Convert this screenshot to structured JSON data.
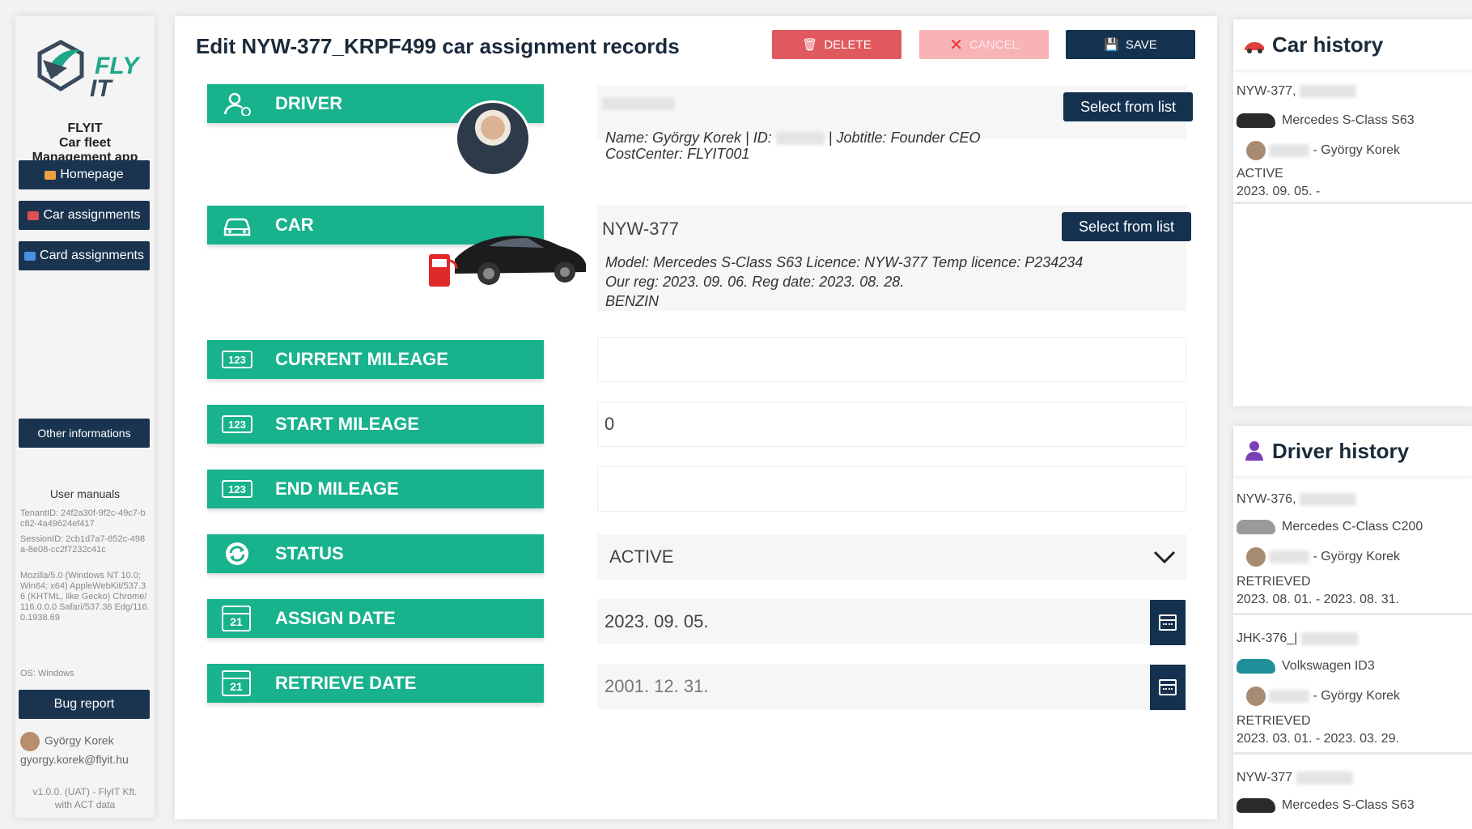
{
  "sidebar": {
    "logo_text_1": "FLY",
    "logo_text_2": "IT",
    "brand_name": "FLYIT",
    "brand_subtitle_1": "Car fleet",
    "brand_subtitle_2": "Management app",
    "nav": [
      {
        "label": "Homepage",
        "icon": "home-icon",
        "icon_color": "#f0a040"
      },
      {
        "label": "Car assignments",
        "icon": "car-icon",
        "icon_color": "#e05050"
      },
      {
        "label": "Card assignments",
        "icon": "card-icon",
        "icon_color": "#4a90e2"
      }
    ],
    "other_info_label": "Other informations",
    "user_manuals_label": "User manuals",
    "tenant_id": "TenantID: 24f2a30f-9f2c-49c7-bc82-4a49624ef417",
    "session_id": "SessionID: 2cb1d7a7-852c-498a-8e08-cc2f7232c41c",
    "user_agent": "Mozilla/5.0 (Windows NT 10.0; Win64; x64) AppleWebKit/537.36 (KHTML, like Gecko) Chrome/116.0.0.0 Safari/537.36 Edg/116.0.1938.69",
    "os": "OS: Windows",
    "bug_report_label": "Bug report",
    "user_name": "György Korek",
    "user_email": "gyorgy.korek@flyit.hu",
    "version_1": "v1.0.0. (UAT) - FlyIT Kft.",
    "version_2": "with ACT data"
  },
  "main": {
    "title": "Edit NYW-377_KRPF499 car assignment records",
    "delete_label": "DELETE",
    "cancel_label": "CANCEL",
    "save_label": "SAVE",
    "driver": {
      "label": "DRIVER",
      "select_label": "Select from list",
      "details_1_a": "Name: György Korek | ID:",
      "details_1_b": "| Jobtitle: Founder CEO",
      "details_2": "CostCenter: FLYIT001"
    },
    "car": {
      "label": "CAR",
      "value": "NYW-377",
      "select_label": "Select from list",
      "details_1": "Model: Mercedes S-Class S63 Licence: NYW-377 Temp licence: P234234",
      "details_2": "Our reg: 2023. 09. 06. Reg date: 2023. 08. 28.",
      "details_3": "BENZIN"
    },
    "current_mileage": {
      "label": "CURRENT MILEAGE",
      "badge": "123",
      "value": ""
    },
    "start_mileage": {
      "label": "START MILEAGE",
      "badge": "123",
      "value": "0"
    },
    "end_mileage": {
      "label": "END MILEAGE",
      "badge": "123",
      "value": ""
    },
    "status": {
      "label": "STATUS",
      "value": "ACTIVE"
    },
    "assign_date": {
      "label": "ASSIGN DATE",
      "cal_day": "21",
      "value": "2023. 09. 05."
    },
    "retrieve_date": {
      "label": "RETRIEVE DATE",
      "cal_day": "21",
      "value": "2001. 12. 31."
    }
  },
  "car_history": {
    "title": "Car history",
    "items": [
      {
        "plate": "NYW-377,",
        "model": "Mercedes S-Class S63",
        "driver": "- György Korek",
        "status": "ACTIVE",
        "dates": "2023. 09. 05. -",
        "car_color": "#2a2a2a"
      }
    ]
  },
  "driver_history": {
    "title": "Driver history",
    "items": [
      {
        "plate": "NYW-376,",
        "model": "Mercedes C-Class C200",
        "driver": "- György Korek",
        "status": "RETRIEVED",
        "dates": "2023. 08. 01. - 2023. 08. 31.",
        "car_color": "#9a9a9a"
      },
      {
        "plate": "JHK-376_|",
        "model": "Volkswagen ID3",
        "driver": "- György Korek",
        "status": "RETRIEVED",
        "dates": "2023. 03. 01. - 2023. 03. 29.",
        "car_color": "#1f8f9a"
      },
      {
        "plate": "NYW-377",
        "model": "Mercedes S-Class S63",
        "car_color": "#2a2a2a"
      }
    ]
  },
  "colors": {
    "accent_green": "#18b28d",
    "navy": "#14314f",
    "delete_red": "#e0595f",
    "cancel_pink": "#f7b3b6"
  }
}
